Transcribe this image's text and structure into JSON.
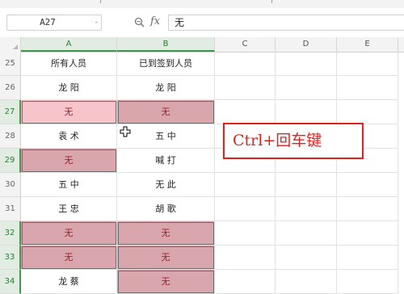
{
  "formula_bar": {
    "name_box": "A27",
    "name_box_dropdown": "-",
    "zoom_icon": "zoom-icon",
    "fx_label": "fx",
    "formula_value": "无"
  },
  "column_headers": [
    "A",
    "B",
    "C",
    "D",
    "E"
  ],
  "rows": [
    {
      "num": "25",
      "a": "所有人员",
      "b": "已到签到人员"
    },
    {
      "num": "26",
      "a": "龙  阳",
      "b": "龙  阳"
    },
    {
      "num": "27",
      "a": "无",
      "b": "无"
    },
    {
      "num": "28",
      "a": "袁  术",
      "b": "五  中"
    },
    {
      "num": "29",
      "a": "无",
      "b": "喊  打"
    },
    {
      "num": "30",
      "a": "五  中",
      "b": "无  此"
    },
    {
      "num": "31",
      "a": "王  忠",
      "b": "胡  歌"
    },
    {
      "num": "32",
      "a": "无",
      "b": "无"
    },
    {
      "num": "33",
      "a": "无",
      "b": "无"
    },
    {
      "num": "34",
      "a": "龙  蔡",
      "b": "无"
    }
  ],
  "callout": {
    "text": "Ctrl+回车键",
    "color": "#e0211c"
  },
  "colors": {
    "highlight_fill": "#d9a6ae",
    "highlight_text": "#9b1c2c",
    "active_fill": "#f8c4cb",
    "selection_green": "#3d9a4c"
  }
}
